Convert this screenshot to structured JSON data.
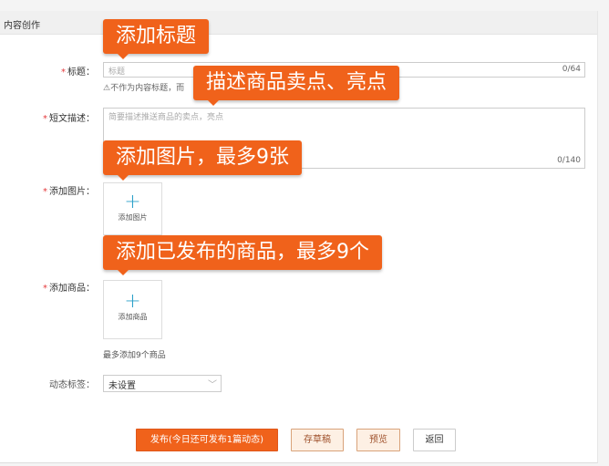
{
  "header": {
    "title": "内容创作"
  },
  "callouts": [
    "添加标题",
    "描述商品卖点、亮点",
    "添加图片，最多9张",
    "添加已发布的商品，最多9个"
  ],
  "form": {
    "required_mark": "*",
    "title": {
      "label": "标题：",
      "placeholder": "标题",
      "counter": "0/64",
      "hint": "⚠不作为内容标题，而"
    },
    "desc": {
      "label": "短文描述：",
      "placeholder": "简要描述推送商品的卖点，亮点",
      "counter": "0/140"
    },
    "images": {
      "label": "添加图片：",
      "button": "添加图片"
    },
    "products": {
      "label": "添加商品：",
      "button": "添加商品",
      "hint": "最多添加9个商品"
    },
    "tag": {
      "label": "动态标签：",
      "value": "未设置"
    }
  },
  "buttons": {
    "publish": "发布(今日还可发布1篇动态)",
    "draft": "存草稿",
    "preview": "预览",
    "back": "返回"
  },
  "colors": {
    "accent": "#f0621b",
    "plus": "#2aa0c9"
  }
}
